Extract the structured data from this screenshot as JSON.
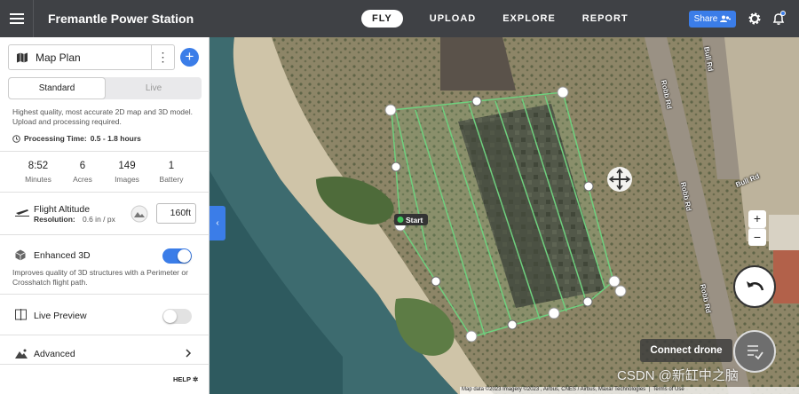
{
  "header": {
    "app_title": "Fremantle Power Station",
    "tabs": [
      {
        "label": "FLY",
        "active": true
      },
      {
        "label": "UPLOAD",
        "active": false
      },
      {
        "label": "EXPLORE",
        "active": false
      },
      {
        "label": "REPORT",
        "active": false
      }
    ],
    "share_label": "Share",
    "accent_color": "#3b7de8"
  },
  "panel": {
    "plan_name": "Map Plan",
    "modes": [
      {
        "label": "Standard",
        "active": true
      },
      {
        "label": "Live",
        "active": false
      }
    ],
    "description": "Highest quality, most accurate 2D map and 3D model. Upload and processing required.",
    "processing_label": "Processing Time:",
    "processing_value": "0.5 - 1.8 hours",
    "stats": [
      {
        "value": "8:52",
        "label": "Minutes"
      },
      {
        "value": "6",
        "label": "Acres"
      },
      {
        "value": "149",
        "label": "Images"
      },
      {
        "value": "1",
        "label": "Battery"
      }
    ],
    "flight_altitude": {
      "label": "Flight Altitude",
      "resolution_label": "Resolution:",
      "resolution_value": "0.6 in / px",
      "altitude_value": "160ft"
    },
    "enhanced_3d": {
      "label": "Enhanced 3D",
      "description": "Improves quality of 3D structures with a Perimeter or Crosshatch flight path.",
      "enabled": true
    },
    "live_preview": {
      "label": "Live Preview",
      "enabled": false
    },
    "advanced_label": "Advanced",
    "help_label": "HELP"
  },
  "map": {
    "start_label": "Start",
    "roads": [
      "Robb Rd",
      "Robb Rd",
      "Robb Rd",
      "Bull Rd",
      "Bull Rd"
    ],
    "zoom_in": "+",
    "zoom_out": "−",
    "connect_drone_label": "Connect drone",
    "attribution": "Map data ©2023 Imagery ©2023 , Airbus, CNES / Airbus, Maxar Technologies",
    "terms_label": "Terms of Use",
    "watermark": "CSDN @新缸中之脑"
  }
}
